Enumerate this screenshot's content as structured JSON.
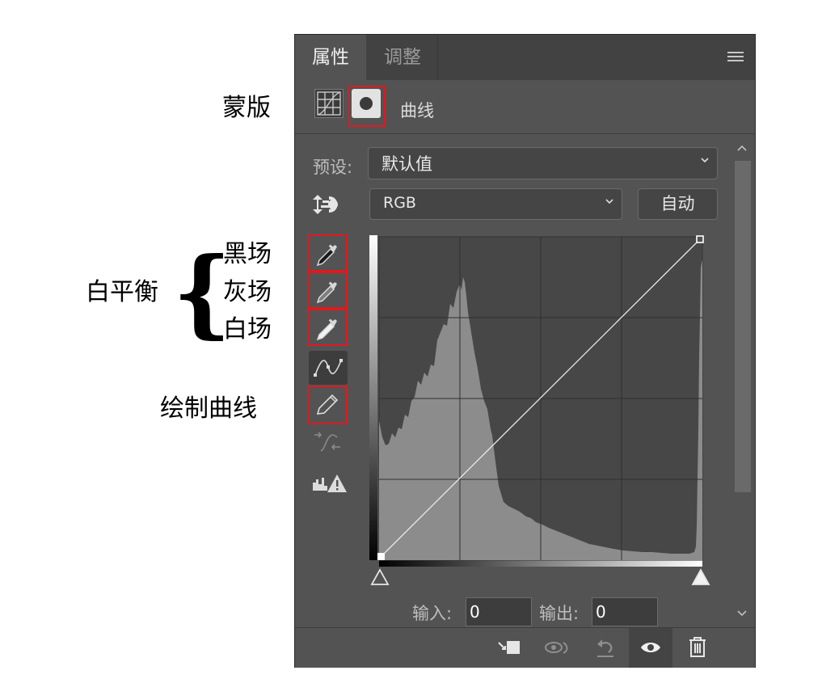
{
  "annotations": {
    "mask": "蒙版",
    "white_balance": "白平衡",
    "brace": "{",
    "black_point": "黑场",
    "gray_point": "灰场",
    "white_point": "白场",
    "draw_curve": "绘制曲线"
  },
  "panel": {
    "tabs": [
      {
        "label": "属性",
        "active": true
      },
      {
        "label": "调整",
        "active": false
      }
    ],
    "header": {
      "title": "曲线"
    },
    "preset": {
      "label": "预设:",
      "value": "默认值"
    },
    "channel": {
      "value": "RGB"
    },
    "auto_button": "自动",
    "input": {
      "label": "输入:",
      "value": "0"
    },
    "output": {
      "label": "输出:",
      "value": "0"
    }
  },
  "colors": {
    "panel_bg": "#535353",
    "tab_bar": "#424242",
    "highlight_box": "#e0191f",
    "histogram": "#8c8c8c",
    "graph_bg": "#474747"
  },
  "icons": [
    "menu-icon",
    "curves-adjustment-icon",
    "mask-icon",
    "chevron-down-icon",
    "target-adjust-icon",
    "black-eyedropper-icon",
    "gray-eyedropper-icon",
    "white-eyedropper-icon",
    "curve-point-icon",
    "pencil-icon",
    "smooth-curve-icon",
    "clipping-warning-icon",
    "clip-to-layer-icon",
    "view-previous-icon",
    "reset-icon",
    "visibility-eye-icon",
    "trash-icon"
  ]
}
